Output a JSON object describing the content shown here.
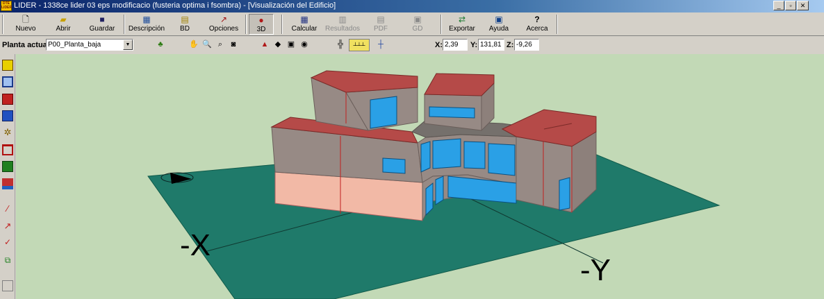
{
  "window": {
    "title": "LIDER - 1338ce lider 03 eps modificacio (fusteria optima i fsombra) - [Visualización del Edificio]",
    "app_icon_text": "LIDER"
  },
  "toolbar": {
    "buttons": [
      {
        "label": "Nuevo",
        "icon": "new-file-icon"
      },
      {
        "label": "Abrir",
        "icon": "open-folder-icon"
      },
      {
        "label": "Guardar",
        "icon": "save-disk-icon"
      },
      {
        "label": "Descripción",
        "icon": "description-icon"
      },
      {
        "label": "BD",
        "icon": "database-icon"
      },
      {
        "label": "Opciones",
        "icon": "options-hammer-icon"
      },
      {
        "label": "3D",
        "icon": "3d-view-icon"
      },
      {
        "label": "Calcular",
        "icon": "calculator-icon"
      },
      {
        "label": "Resultados",
        "icon": "results-chart-icon"
      },
      {
        "label": "PDF",
        "icon": "pdf-icon"
      },
      {
        "label": "GD",
        "icon": "gd-icon"
      },
      {
        "label": "Exportar",
        "icon": "export-icon"
      },
      {
        "label": "Ayuda",
        "icon": "help-icon"
      },
      {
        "label": "Acerca",
        "icon": "about-question-icon"
      }
    ]
  },
  "toolbar2": {
    "planta_label": "Planta actual",
    "planta_value": "P00_Planta_baja",
    "x_label": "X:",
    "x_value": "2,39",
    "y_label": "Y:",
    "y_value": "131,81",
    "z_label": "Z:",
    "z_value": "-9,26"
  },
  "viewport": {
    "axis_x_label": "-X",
    "axis_y_label": "-Y",
    "colors": {
      "background": "#c2d9b6",
      "ground": "#1f7a6a",
      "wall": "#978a85",
      "wall_ground_floor": "#f2b9a6",
      "roof": "#b54a48",
      "window": "#2aa0e6"
    }
  }
}
